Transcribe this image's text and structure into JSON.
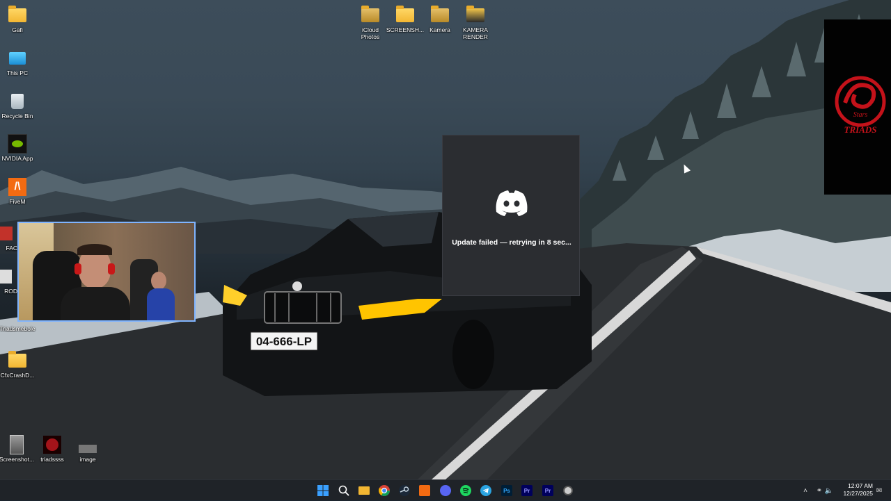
{
  "desktop": {
    "left_icons": [
      {
        "name": "gafi-folder",
        "label": "Gafi"
      },
      {
        "name": "this-pc",
        "label": "This PC"
      },
      {
        "name": "recycle-bin",
        "label": "Recycle Bin"
      },
      {
        "name": "nvidia-app",
        "label": "NVIDIA App"
      },
      {
        "name": "fivem",
        "label": "FiveM"
      },
      {
        "name": "partial-fac",
        "label": "FAC"
      },
      {
        "name": "partial-rod",
        "label": "ROD"
      },
      {
        "name": "triadsmebole",
        "label": "Triadsmebole"
      },
      {
        "name": "cfxcrash",
        "label": "CfxCrashD..."
      }
    ],
    "top_icons": [
      {
        "label_line1": "iCloud",
        "label_line2": "Photos"
      },
      {
        "label_line1": "SCREENSH...",
        "label_line2": ""
      },
      {
        "label_line1": "Kamera",
        "label_line2": ""
      },
      {
        "label_line1": "KAMERA",
        "label_line2": "RENDER"
      }
    ],
    "bottom_icons": [
      {
        "label": "Screenshot..."
      },
      {
        "label": "triadssss"
      },
      {
        "label": "image"
      }
    ],
    "license_plate": "04-666-LP"
  },
  "discord_dialog": {
    "message": "Update failed — retrying in 8 sec..."
  },
  "triads_panel": {
    "text_line1": "Stars",
    "text_line2": "TRIADS"
  },
  "taskbar": {
    "apps": [
      "start",
      "search",
      "file-explorer",
      "chrome",
      "steam",
      "fivem",
      "discord",
      "spotify",
      "telegram",
      "Ps",
      "Pr",
      "Pr",
      "obs"
    ],
    "ps_label": "Ps",
    "pr_label": "Pr",
    "pr2_label": "Pr",
    "clock_time": "12:07 AM",
    "clock_date": "12/27/2025"
  },
  "colors": {
    "discord_blurple": "#ffffff",
    "dialog_bg": "#2b2d31",
    "taskbar_bg": "#1f2328",
    "triads_red": "#c4121a"
  }
}
